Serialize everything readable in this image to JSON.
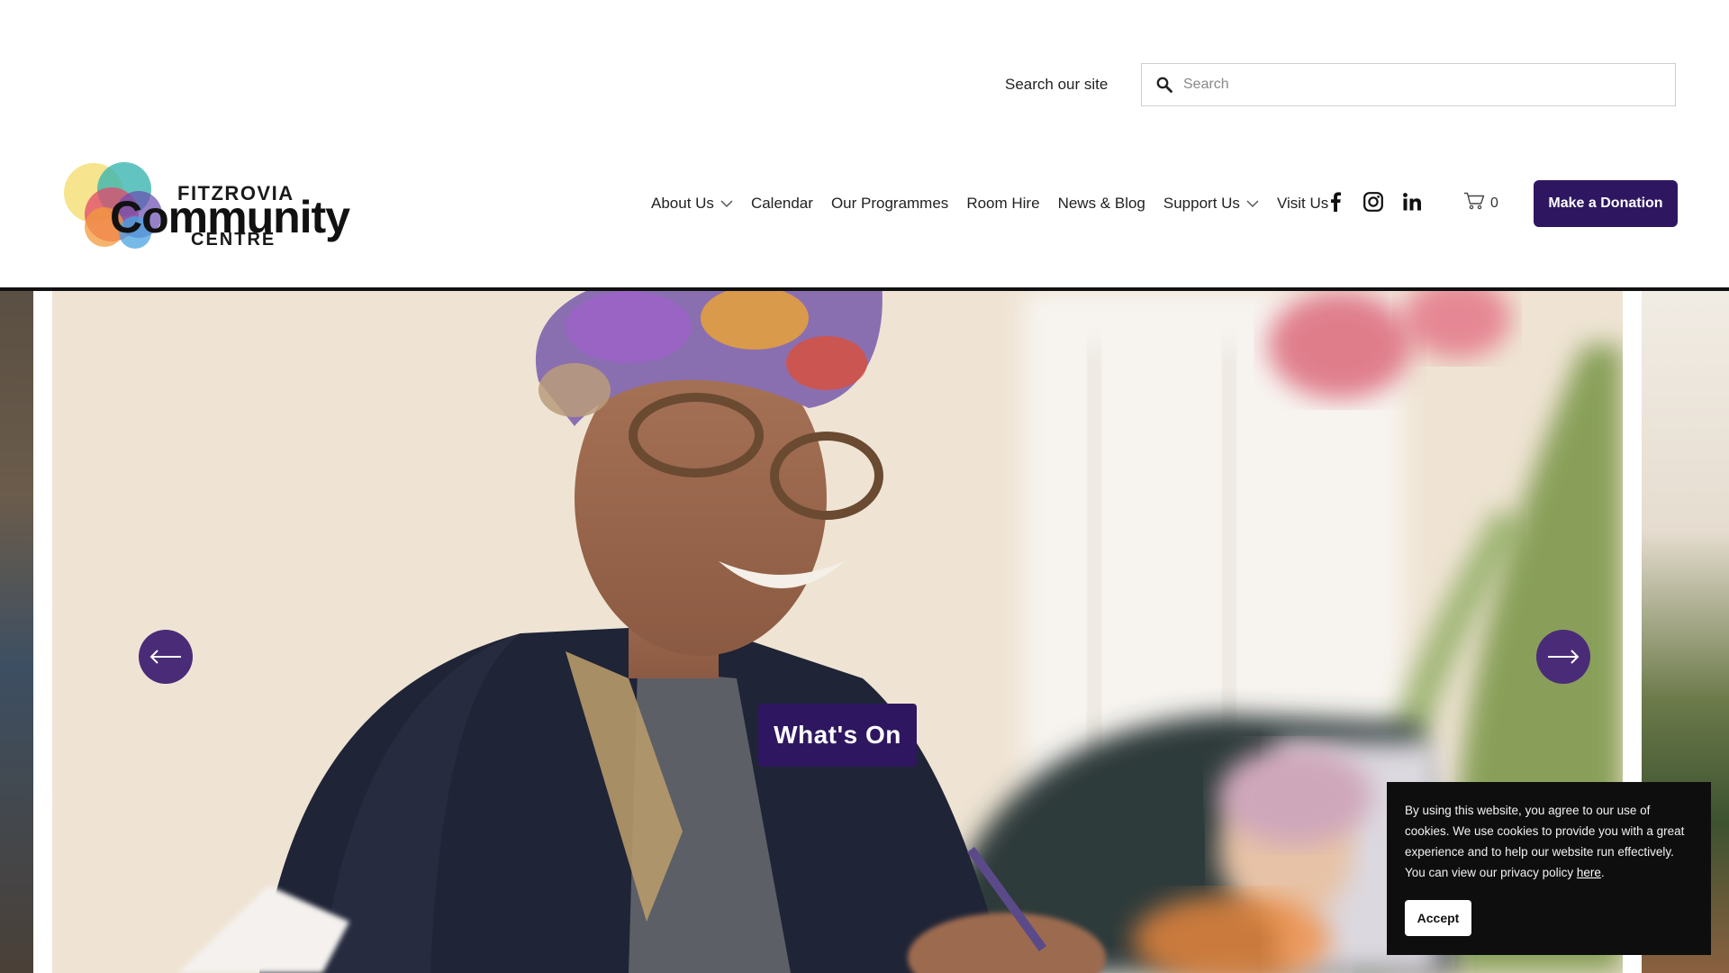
{
  "search": {
    "label": "Search our site",
    "placeholder": "Search",
    "value": ""
  },
  "logo": {
    "line1": "FITZROVIA",
    "line2": "Community",
    "line3": "CENTRE"
  },
  "nav": {
    "items": [
      {
        "label": "About Us",
        "has_dropdown": true
      },
      {
        "label": "Calendar",
        "has_dropdown": false
      },
      {
        "label": "Our Programmes",
        "has_dropdown": false
      },
      {
        "label": "Room Hire",
        "has_dropdown": false
      },
      {
        "label": "News & Blog",
        "has_dropdown": false
      },
      {
        "label": "Support Us",
        "has_dropdown": true
      },
      {
        "label": "Visit Us",
        "has_dropdown": false
      }
    ]
  },
  "social": {
    "icons": [
      "facebook-icon",
      "instagram-icon",
      "linkedin-icon"
    ]
  },
  "cart": {
    "count": "0"
  },
  "donate": {
    "label": "Make a Donation"
  },
  "hero": {
    "cta_label": "What's On"
  },
  "cookie": {
    "text": "By using this website, you agree to our use of cookies. We use cookies to provide you with a great experience and to help our website run effectively. You can view our privacy policy ",
    "link_text": "here",
    "after_link": ".",
    "accept_label": "Accept"
  },
  "colors": {
    "brand_purple": "#2e1760",
    "arrow_purple": "#4a2b78",
    "cookie_bg": "#0e0e0e"
  }
}
